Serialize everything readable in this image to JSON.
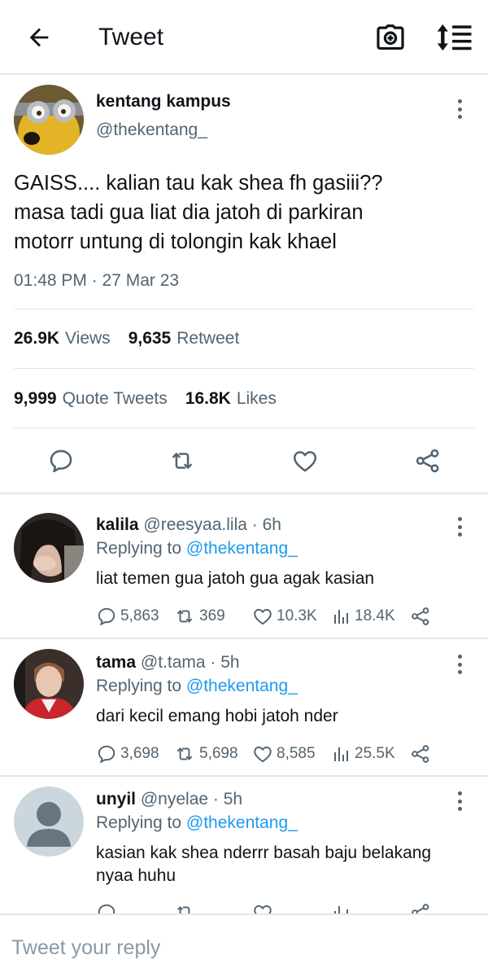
{
  "header": {
    "title": "Tweet",
    "back_icon": "arrow-left-icon",
    "camera_icon": "camera-plus-icon",
    "sort_icon": "sort-icon"
  },
  "tweet": {
    "display_name": "kentang kampus",
    "handle": "@thekentang_",
    "text_lines": [
      "GAISS.... kalian tau kak shea fh gasiii??",
      "masa tadi gua liat dia jatoh di parkiran",
      "motorr untung di tolongin kak khael"
    ],
    "timestamp": "01:48 PM · 27 Mar 23",
    "views_count": "26.9K",
    "views_label": "Views",
    "retweet_count": "9,635",
    "retweet_label": "Retweet",
    "quote_count": "9,999",
    "quote_label": "Quote Tweets",
    "likes_count": "16.8K",
    "likes_label": "Likes"
  },
  "replies": [
    {
      "name": "kalila",
      "handle": "@reesyaa.lila",
      "time": "6h",
      "replying_prefix": "Replying to ",
      "replying_to": "@thekentang_",
      "text": "liat temen gua jatoh gua agak kasian",
      "reply_count": "5,863",
      "retweet_count": "369",
      "like_count": "10.3K",
      "view_count": "18.4K"
    },
    {
      "name": "tama",
      "handle": "@t.tama",
      "time": "5h",
      "replying_prefix": "Replying to ",
      "replying_to": "@thekentang_",
      "text": "dari kecil emang hobi jatoh nder",
      "reply_count": "3,698",
      "retweet_count": "5,698",
      "like_count": "8,585",
      "view_count": "25.5K"
    },
    {
      "name": "unyil",
      "handle": "@nyelae",
      "time": "5h",
      "replying_prefix": "Replying to ",
      "replying_to": "@thekentang_",
      "text_lines": [
        "kasian kak shea nderrr basah baju belakang",
        "nyaa huhu"
      ]
    }
  ],
  "reply_box": {
    "placeholder": "Tweet your reply"
  },
  "colors": {
    "text": "#0f1419",
    "secondary": "#536471",
    "link": "#1d9bf0",
    "divider": "#e6e6e6"
  }
}
